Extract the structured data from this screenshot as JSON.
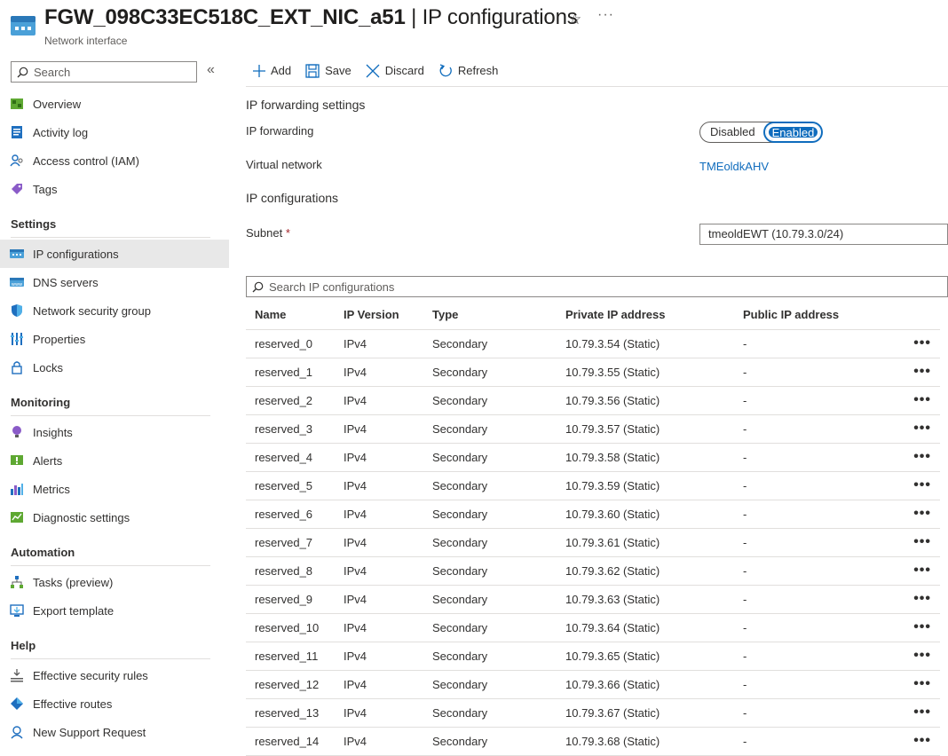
{
  "header": {
    "resource_name": "FGW_098C33EC518C_EXT_NIC_a51",
    "separator": " | ",
    "page_name": "IP configurations",
    "resource_type": "Network interface",
    "star_icon": "☆",
    "more_icon": "···"
  },
  "sidebar": {
    "search_placeholder": "Search",
    "collapse_icon": "«",
    "top_items": [
      {
        "label": "Overview",
        "icon": "overview-icon"
      },
      {
        "label": "Activity log",
        "icon": "activity-log-icon"
      },
      {
        "label": "Access control (IAM)",
        "icon": "iam-icon"
      },
      {
        "label": "Tags",
        "icon": "tag-icon"
      }
    ],
    "settings_header": "Settings",
    "settings_items": [
      {
        "label": "IP configurations",
        "icon": "ip-config-icon",
        "active": true
      },
      {
        "label": "DNS servers",
        "icon": "dns-icon"
      },
      {
        "label": "Network security group",
        "icon": "shield-icon"
      },
      {
        "label": "Properties",
        "icon": "properties-icon"
      },
      {
        "label": "Locks",
        "icon": "lock-icon"
      }
    ],
    "monitoring_header": "Monitoring",
    "monitoring_items": [
      {
        "label": "Insights",
        "icon": "insights-icon"
      },
      {
        "label": "Alerts",
        "icon": "alerts-icon"
      },
      {
        "label": "Metrics",
        "icon": "metrics-icon"
      },
      {
        "label": "Diagnostic settings",
        "icon": "diagnostic-icon"
      }
    ],
    "automation_header": "Automation",
    "automation_items": [
      {
        "label": "Tasks (preview)",
        "icon": "tasks-icon"
      },
      {
        "label": "Export template",
        "icon": "export-icon"
      }
    ],
    "help_header": "Help",
    "help_items": [
      {
        "label": "Effective security rules",
        "icon": "security-rules-icon"
      },
      {
        "label": "Effective routes",
        "icon": "routes-icon"
      },
      {
        "label": "New Support Request",
        "icon": "support-icon"
      }
    ]
  },
  "toolbar": {
    "add_label": "Add",
    "save_label": "Save",
    "discard_label": "Discard",
    "refresh_label": "Refresh"
  },
  "forwarding": {
    "section_title": "IP forwarding settings",
    "ip_forwarding_label": "IP forwarding",
    "disabled_label": "Disabled",
    "enabled_label": "Enabled",
    "selected": "Enabled",
    "virtual_network_label": "Virtual network",
    "virtual_network_value": "TMEoldkAHV"
  },
  "ipconfig": {
    "section_title": "IP configurations",
    "subnet_label": "Subnet",
    "required_marker": "*",
    "subnet_value": "tmeoldEWT (10.79.3.0/24)",
    "search_placeholder": "Search IP configurations"
  },
  "table": {
    "columns": [
      "Name",
      "IP Version",
      "Type",
      "Private IP address",
      "Public IP address"
    ],
    "more_icon": "•••",
    "rows": [
      {
        "name": "reserved_0",
        "version": "IPv4",
        "type": "Secondary",
        "private_ip": "10.79.3.54 (Static)",
        "public_ip": "-"
      },
      {
        "name": "reserved_1",
        "version": "IPv4",
        "type": "Secondary",
        "private_ip": "10.79.3.55 (Static)",
        "public_ip": "-"
      },
      {
        "name": "reserved_2",
        "version": "IPv4",
        "type": "Secondary",
        "private_ip": "10.79.3.56 (Static)",
        "public_ip": "-"
      },
      {
        "name": "reserved_3",
        "version": "IPv4",
        "type": "Secondary",
        "private_ip": "10.79.3.57 (Static)",
        "public_ip": "-"
      },
      {
        "name": "reserved_4",
        "version": "IPv4",
        "type": "Secondary",
        "private_ip": "10.79.3.58 (Static)",
        "public_ip": "-"
      },
      {
        "name": "reserved_5",
        "version": "IPv4",
        "type": "Secondary",
        "private_ip": "10.79.3.59 (Static)",
        "public_ip": "-"
      },
      {
        "name": "reserved_6",
        "version": "IPv4",
        "type": "Secondary",
        "private_ip": "10.79.3.60 (Static)",
        "public_ip": "-"
      },
      {
        "name": "reserved_7",
        "version": "IPv4",
        "type": "Secondary",
        "private_ip": "10.79.3.61 (Static)",
        "public_ip": "-"
      },
      {
        "name": "reserved_8",
        "version": "IPv4",
        "type": "Secondary",
        "private_ip": "10.79.3.62 (Static)",
        "public_ip": "-"
      },
      {
        "name": "reserved_9",
        "version": "IPv4",
        "type": "Secondary",
        "private_ip": "10.79.3.63 (Static)",
        "public_ip": "-"
      },
      {
        "name": "reserved_10",
        "version": "IPv4",
        "type": "Secondary",
        "private_ip": "10.79.3.64 (Static)",
        "public_ip": "-"
      },
      {
        "name": "reserved_11",
        "version": "IPv4",
        "type": "Secondary",
        "private_ip": "10.79.3.65 (Static)",
        "public_ip": "-"
      },
      {
        "name": "reserved_12",
        "version": "IPv4",
        "type": "Secondary",
        "private_ip": "10.79.3.66 (Static)",
        "public_ip": "-"
      },
      {
        "name": "reserved_13",
        "version": "IPv4",
        "type": "Secondary",
        "private_ip": "10.79.3.67 (Static)",
        "public_ip": "-"
      },
      {
        "name": "reserved_14",
        "version": "IPv4",
        "type": "Secondary",
        "private_ip": "10.79.3.68 (Static)",
        "public_ip": "-"
      }
    ]
  },
  "colors": {
    "accent": "#0f6cbd",
    "active_nav": "#e8e8e8",
    "required": "#a4262c"
  }
}
